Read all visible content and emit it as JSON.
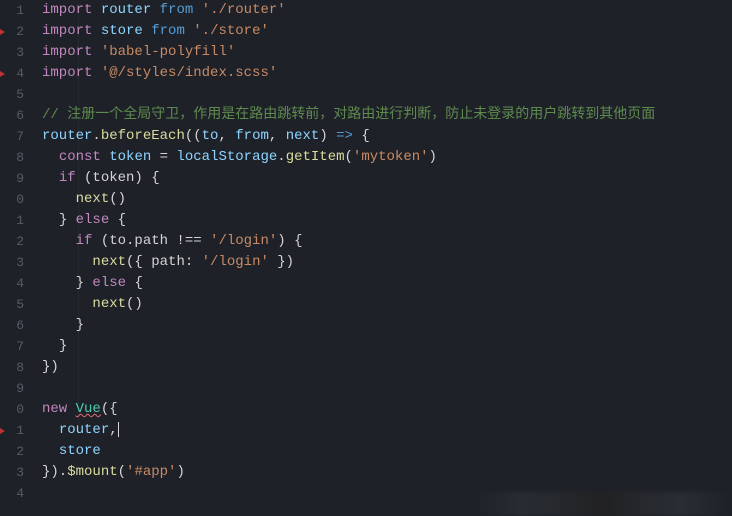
{
  "gutter": [
    "1",
    "2",
    "3",
    "4",
    "5",
    "6",
    "7",
    "8",
    "9",
    "0",
    "1",
    "2",
    "3",
    "4",
    "5",
    "6",
    "7",
    "8",
    "9",
    "0",
    "1",
    "2",
    "3",
    "4"
  ],
  "markers": [
    1,
    3,
    20
  ],
  "tokens": {
    "kw_import": "import",
    "id_router": "router",
    "kw_from": "from",
    "str_router": "'./router'",
    "id_store": "store",
    "str_store": "'./store'",
    "str_babel": "'babel-polyfill'",
    "str_styles": "'@/styles/index.scss'",
    "comment": "// 注册一个全局守卫，作用是在路由跳转前，对路由进行判断，防止未登录的用户跳转到其他页面",
    "id_router2": "router",
    "dot1": ".",
    "fn_beforeEach": "beforeEach",
    "paren_open": "(",
    "paren_open2": "(",
    "id_to": "to",
    "comma1": ", ",
    "id_from": "from",
    "comma2": ", ",
    "id_next": "next",
    "paren_close2": ")",
    "arrow": " => ",
    "brace_open": "{",
    "kw_const": "const",
    "id_token": "token",
    "eq": " = ",
    "id_localStorage": "localStorage",
    "dot2": ".",
    "fn_getItem": "getItem",
    "str_mytoken": "'mytoken'",
    "paren_close3": ")",
    "kw_if": "if",
    "cond_token": " (token) {",
    "fn_next1": "next",
    "call_empty": "()",
    "brace_close1": "}",
    "kw_else": " else ",
    "brace_open2": "{",
    "cond_path_open": " (to.path !== ",
    "str_login": "'/login'",
    "cond_path_close": ") {",
    "fn_next2": "next",
    "obj_open": "({ path: ",
    "str_login2": "'/login'",
    "obj_close": " })",
    "brace_close2": "}",
    "fn_next3": "next",
    "brace_close3": "}",
    "brace_close4": "}",
    "brace_close5": "})",
    "kw_new": "new",
    "cls_Vue": "Vue",
    "vue_open": "({",
    "id_router3": "router",
    "trail_comma": ",",
    "id_store2": "store",
    "vue_close": "}).",
    "fn_mount": "$mount",
    "str_app": "'#app'",
    "paren_close_final": ")"
  }
}
